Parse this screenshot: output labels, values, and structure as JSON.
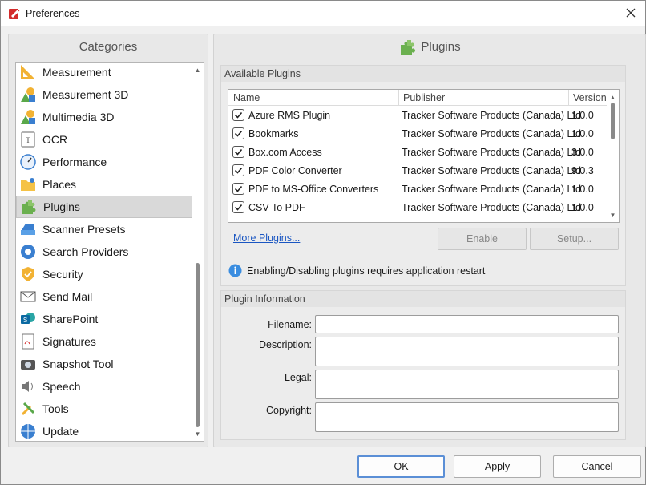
{
  "window": {
    "title": "Preferences",
    "close_label": "×"
  },
  "categories": {
    "title": "Categories",
    "items": [
      {
        "label": "Measurement",
        "icon": "ruler-icon",
        "selected": false
      },
      {
        "label": "Measurement 3D",
        "icon": "measurement-3d-icon",
        "selected": false
      },
      {
        "label": "Multimedia 3D",
        "icon": "multimedia-3d-icon",
        "selected": false
      },
      {
        "label": "OCR",
        "icon": "ocr-icon",
        "selected": false
      },
      {
        "label": "Performance",
        "icon": "gauge-icon",
        "selected": false
      },
      {
        "label": "Places",
        "icon": "folder-places-icon",
        "selected": false
      },
      {
        "label": "Plugins",
        "icon": "puzzle-icon",
        "selected": true
      },
      {
        "label": "Scanner Presets",
        "icon": "scanner-icon",
        "selected": false
      },
      {
        "label": "Search Providers",
        "icon": "globe-search-icon",
        "selected": false
      },
      {
        "label": "Security",
        "icon": "shield-icon",
        "selected": false
      },
      {
        "label": "Send Mail",
        "icon": "envelope-icon",
        "selected": false
      },
      {
        "label": "SharePoint",
        "icon": "sharepoint-icon",
        "selected": false
      },
      {
        "label": "Signatures",
        "icon": "signature-icon",
        "selected": false
      },
      {
        "label": "Snapshot Tool",
        "icon": "camera-icon",
        "selected": false
      },
      {
        "label": "Speech",
        "icon": "speaker-icon",
        "selected": false
      },
      {
        "label": "Tools",
        "icon": "tools-icon",
        "selected": false
      },
      {
        "label": "Update",
        "icon": "globe-update-icon",
        "selected": false
      }
    ]
  },
  "plugins_page": {
    "title": "Plugins",
    "available_group": "Available Plugins",
    "columns": {
      "name": "Name",
      "publisher": "Publisher",
      "version": "Version"
    },
    "rows": [
      {
        "name": "Azure RMS Plugin",
        "publisher": "Tracker Software Products (Canada) Ltd",
        "version": "1.0.0",
        "checked": true
      },
      {
        "name": "Bookmarks",
        "publisher": "Tracker Software Products (Canada) Ltd",
        "version": "1.0.0",
        "checked": true
      },
      {
        "name": "Box.com Access",
        "publisher": "Tracker Software Products (Canada) Ltd",
        "version": "3.0.0",
        "checked": true
      },
      {
        "name": "PDF Color Converter",
        "publisher": "Tracker Software Products (Canada) Ltd",
        "version": "9.0.3",
        "checked": true
      },
      {
        "name": "PDF to MS-Office Converters",
        "publisher": "Tracker Software Products (Canada) Ltd",
        "version": "1.0.0",
        "checked": true
      },
      {
        "name": "CSV To PDF",
        "publisher": "Tracker Software Products (Canada) Ltd",
        "version": "1.0.0",
        "checked": true
      }
    ],
    "more_plugins_link": "More Plugins...",
    "enable_button": "Enable",
    "setup_button": "Setup...",
    "restart_notice": "Enabling/Disabling plugins requires application restart",
    "info_group": "Plugin Information",
    "fields": {
      "filename_label": "Filename:",
      "description_label": "Description:",
      "legal_label": "Legal:",
      "copyright_label": "Copyright:",
      "filename_value": "",
      "description_value": "",
      "legal_value": "",
      "copyright_value": ""
    }
  },
  "footer": {
    "ok": "OK",
    "apply": "Apply",
    "cancel": "Cancel"
  },
  "colors": {
    "accent": "#5b8fd6",
    "link": "#1a56c2",
    "puzzle_green": "#5aa84a",
    "selection": "#d9d9d9"
  }
}
